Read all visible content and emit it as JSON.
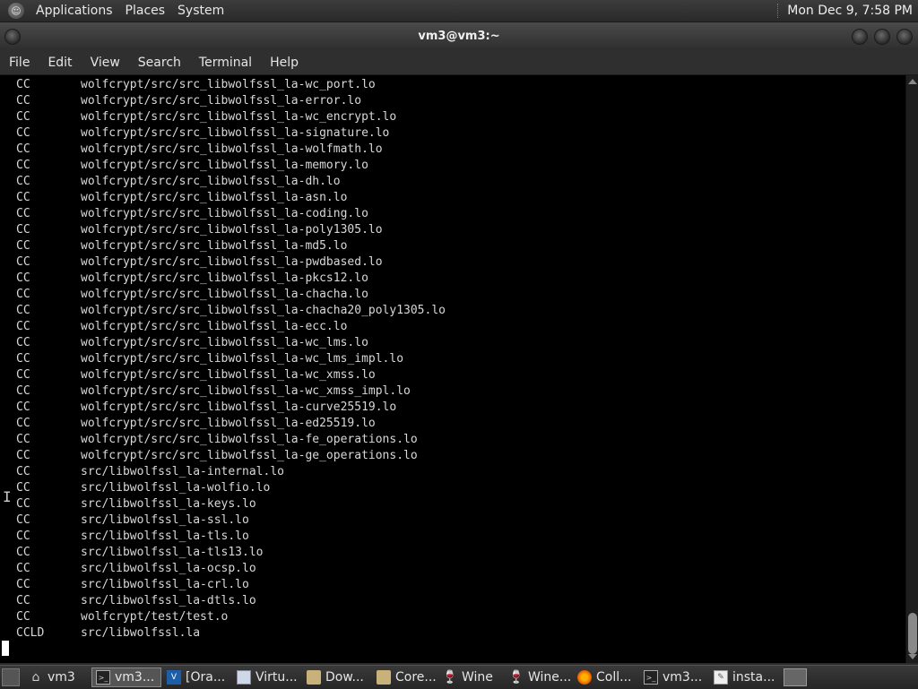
{
  "top_panel": {
    "menus": [
      "Applications",
      "Places",
      "System"
    ],
    "clock": "Mon Dec 9,  7:58 PM"
  },
  "window": {
    "title": "vm3@vm3:~"
  },
  "menubar": [
    "File",
    "Edit",
    "View",
    "Search",
    "Terminal",
    "Help"
  ],
  "terminal": {
    "lines": [
      {
        "cmd": "CC",
        "path": "wolfcrypt/src/src_libwolfssl_la-wc_port.lo"
      },
      {
        "cmd": "CC",
        "path": "wolfcrypt/src/src_libwolfssl_la-error.lo"
      },
      {
        "cmd": "CC",
        "path": "wolfcrypt/src/src_libwolfssl_la-wc_encrypt.lo"
      },
      {
        "cmd": "CC",
        "path": "wolfcrypt/src/src_libwolfssl_la-signature.lo"
      },
      {
        "cmd": "CC",
        "path": "wolfcrypt/src/src_libwolfssl_la-wolfmath.lo"
      },
      {
        "cmd": "CC",
        "path": "wolfcrypt/src/src_libwolfssl_la-memory.lo"
      },
      {
        "cmd": "CC",
        "path": "wolfcrypt/src/src_libwolfssl_la-dh.lo"
      },
      {
        "cmd": "CC",
        "path": "wolfcrypt/src/src_libwolfssl_la-asn.lo"
      },
      {
        "cmd": "CC",
        "path": "wolfcrypt/src/src_libwolfssl_la-coding.lo"
      },
      {
        "cmd": "CC",
        "path": "wolfcrypt/src/src_libwolfssl_la-poly1305.lo"
      },
      {
        "cmd": "CC",
        "path": "wolfcrypt/src/src_libwolfssl_la-md5.lo"
      },
      {
        "cmd": "CC",
        "path": "wolfcrypt/src/src_libwolfssl_la-pwdbased.lo"
      },
      {
        "cmd": "CC",
        "path": "wolfcrypt/src/src_libwolfssl_la-pkcs12.lo"
      },
      {
        "cmd": "CC",
        "path": "wolfcrypt/src/src_libwolfssl_la-chacha.lo"
      },
      {
        "cmd": "CC",
        "path": "wolfcrypt/src/src_libwolfssl_la-chacha20_poly1305.lo"
      },
      {
        "cmd": "CC",
        "path": "wolfcrypt/src/src_libwolfssl_la-ecc.lo"
      },
      {
        "cmd": "CC",
        "path": "wolfcrypt/src/src_libwolfssl_la-wc_lms.lo"
      },
      {
        "cmd": "CC",
        "path": "wolfcrypt/src/src_libwolfssl_la-wc_lms_impl.lo"
      },
      {
        "cmd": "CC",
        "path": "wolfcrypt/src/src_libwolfssl_la-wc_xmss.lo"
      },
      {
        "cmd": "CC",
        "path": "wolfcrypt/src/src_libwolfssl_la-wc_xmss_impl.lo"
      },
      {
        "cmd": "CC",
        "path": "wolfcrypt/src/src_libwolfssl_la-curve25519.lo"
      },
      {
        "cmd": "CC",
        "path": "wolfcrypt/src/src_libwolfssl_la-ed25519.lo"
      },
      {
        "cmd": "CC",
        "path": "wolfcrypt/src/src_libwolfssl_la-fe_operations.lo"
      },
      {
        "cmd": "CC",
        "path": "wolfcrypt/src/src_libwolfssl_la-ge_operations.lo"
      },
      {
        "cmd": "CC",
        "path": "src/libwolfssl_la-internal.lo"
      },
      {
        "cmd": "CC",
        "path": "src/libwolfssl_la-wolfio.lo"
      },
      {
        "cmd": "CC",
        "path": "src/libwolfssl_la-keys.lo"
      },
      {
        "cmd": "CC",
        "path": "src/libwolfssl_la-ssl.lo"
      },
      {
        "cmd": "CC",
        "path": "src/libwolfssl_la-tls.lo"
      },
      {
        "cmd": "CC",
        "path": "src/libwolfssl_la-tls13.lo"
      },
      {
        "cmd": "CC",
        "path": "src/libwolfssl_la-ocsp.lo"
      },
      {
        "cmd": "CC",
        "path": "src/libwolfssl_la-crl.lo"
      },
      {
        "cmd": "CC",
        "path": "src/libwolfssl_la-dtls.lo"
      },
      {
        "cmd": "CC",
        "path": "wolfcrypt/test/test.o"
      },
      {
        "cmd": "CCLD",
        "path": "src/libwolfssl.la"
      }
    ]
  },
  "taskbar": {
    "tasks": [
      {
        "label": "vm3",
        "icon": "home-folder-icon",
        "glyph": "⌂",
        "cls": "home",
        "active": false,
        "width": 72
      },
      {
        "label": "vm3...",
        "icon": "terminal-icon",
        "glyph": "&gt;_",
        "cls": "term",
        "active": true,
        "width": 78
      },
      {
        "label": "[Ora...",
        "icon": "virtualbox-icon",
        "glyph": "V",
        "cls": "vbox",
        "active": false,
        "width": 76
      },
      {
        "label": "Virtu...",
        "icon": "virtual-machine-icon",
        "glyph": "",
        "cls": "virt",
        "active": false,
        "width": 76
      },
      {
        "label": "Dow...",
        "icon": "folder-icon",
        "glyph": "",
        "cls": "folder",
        "active": false,
        "width": 76
      },
      {
        "label": "Core...",
        "icon": "folder-icon",
        "glyph": "",
        "cls": "folder",
        "active": false,
        "width": 72
      },
      {
        "label": "Wine",
        "icon": "wine-icon",
        "glyph": "🍷",
        "cls": "wine",
        "active": false,
        "width": 72
      },
      {
        "label": "Wine...",
        "icon": "wine-icon",
        "glyph": "🍷",
        "cls": "wine",
        "active": false,
        "width": 74
      },
      {
        "label": "Coll...",
        "icon": "firefox-icon",
        "glyph": "",
        "cls": "ff",
        "active": false,
        "width": 72
      },
      {
        "label": "vm3...",
        "icon": "terminal-icon",
        "glyph": "&gt;_",
        "cls": "term",
        "active": false,
        "width": 76
      },
      {
        "label": "insta...",
        "icon": "text-editor-icon",
        "glyph": "✎",
        "cls": "edit",
        "active": false,
        "width": 76
      }
    ]
  }
}
